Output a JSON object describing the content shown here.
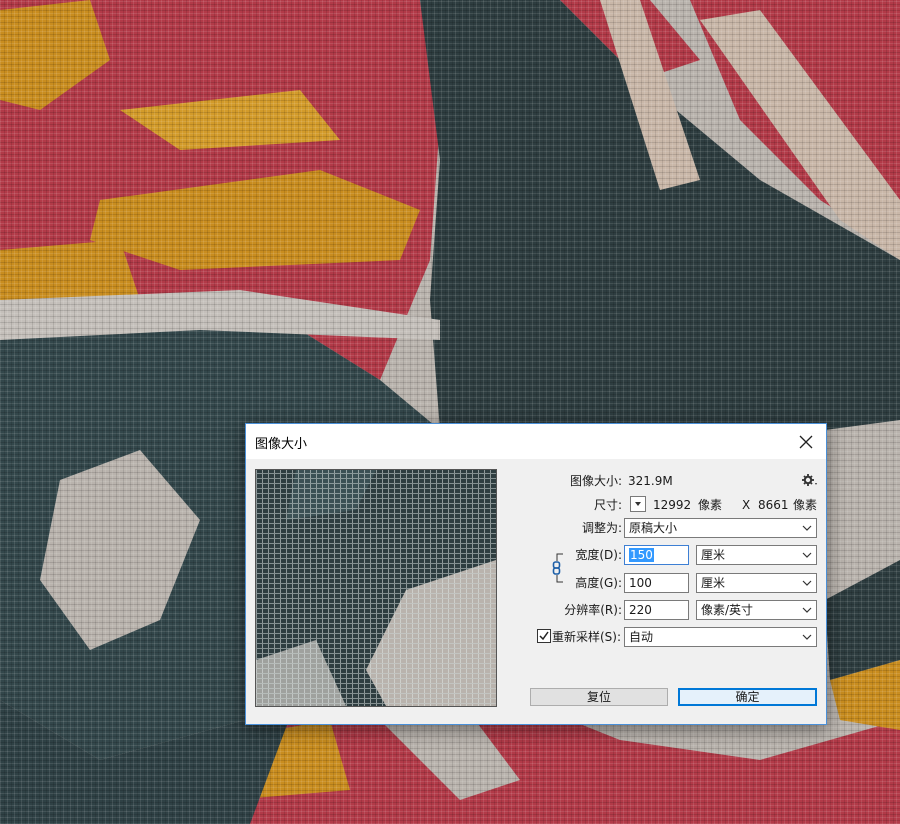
{
  "dialog": {
    "title": "图像大小",
    "image_size_label": "图像大小:",
    "image_size_value": "321.9M",
    "dimensions_label": "尺寸:",
    "dimensions_width": "12992",
    "dimensions_unit_a": "像素",
    "dimensions_x": "X",
    "dimensions_height": "8661",
    "dimensions_unit_b": "像素",
    "fit_to_label": "调整为:",
    "fit_to_value": "原稿大小",
    "width_label": "宽度(D):",
    "width_value": "150",
    "width_unit": "厘米",
    "height_label": "高度(G):",
    "height_value": "100",
    "height_unit": "厘米",
    "resolution_label": "分辨率(R):",
    "resolution_value": "220",
    "resolution_unit": "像素/英寸",
    "resample_label": "重新采样(S):",
    "resample_checked": true,
    "resample_value": "自动",
    "reset_button": "复位",
    "ok_button": "确定"
  },
  "colors": {
    "accent": "#0078d7",
    "selection": "#3399ff",
    "fabric_red": "#b23a48",
    "fabric_teal": "#2e3d40",
    "fabric_gold": "#c98d1f",
    "fabric_grey": "#b9b3ad"
  },
  "icons": {
    "gear": "gear-icon",
    "close": "close-icon",
    "link": "chain-link-icon",
    "dropdown": "chevron-down-icon",
    "checkbox": "checkmark-icon"
  }
}
